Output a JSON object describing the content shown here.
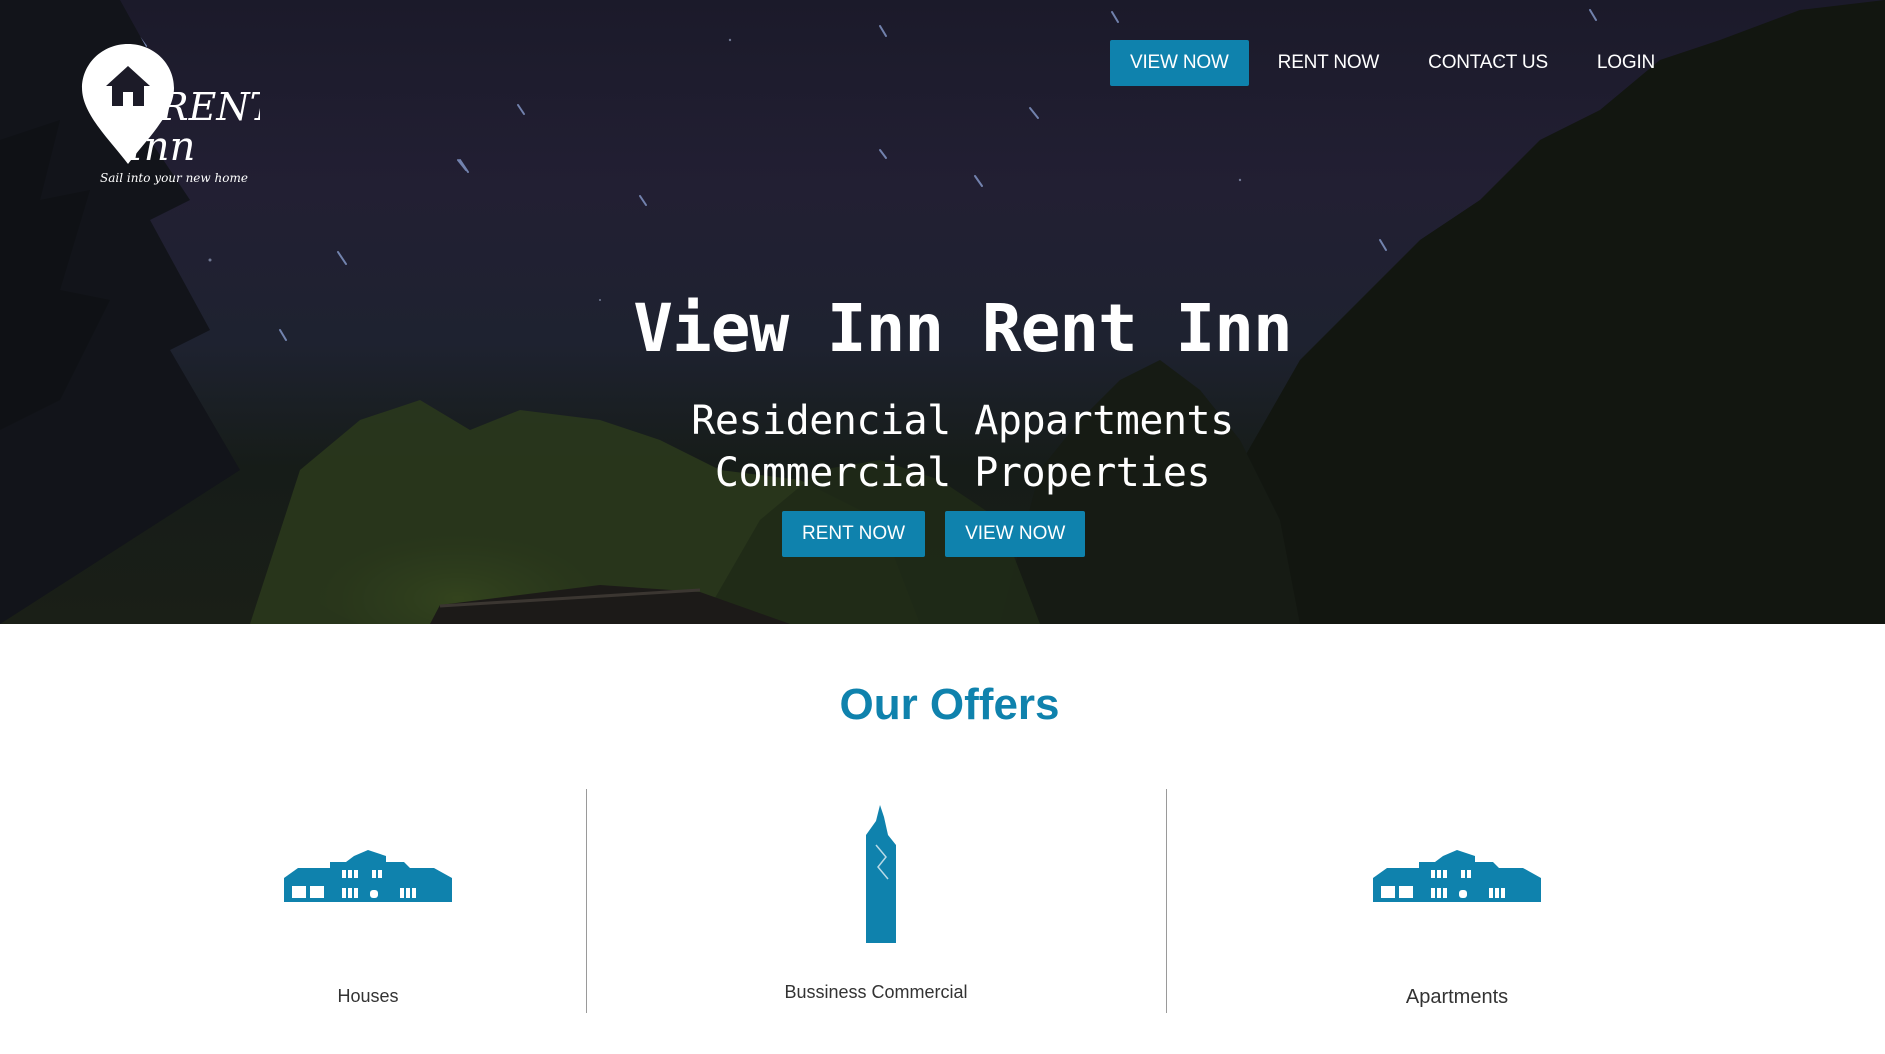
{
  "brand": {
    "logo_word_1": "RENT",
    "logo_word_2": "Inn",
    "tagline": "Sail into your new home"
  },
  "nav": {
    "items": [
      {
        "label": "VIEW NOW",
        "active": true
      },
      {
        "label": "RENT NOW",
        "active": false
      },
      {
        "label": "CONTACT US",
        "active": false
      },
      {
        "label": "LOGIN",
        "active": false
      }
    ]
  },
  "hero": {
    "title": "View Inn Rent Inn",
    "subtitle_line_1": "Residencial Appartments",
    "subtitle_line_2": "Commercial Properties",
    "buttons": [
      {
        "label": "RENT NOW"
      },
      {
        "label": "VIEW NOW"
      }
    ]
  },
  "offers": {
    "title": "Our Offers",
    "items": [
      {
        "label": "Houses",
        "icon": "house-icon"
      },
      {
        "label": "Bussiness Commercial",
        "icon": "skyscraper-icon"
      },
      {
        "label": "Apartments",
        "icon": "apartment-icon"
      }
    ]
  },
  "colors": {
    "accent": "#0f82ad",
    "text_dark": "#333333",
    "white": "#ffffff"
  }
}
